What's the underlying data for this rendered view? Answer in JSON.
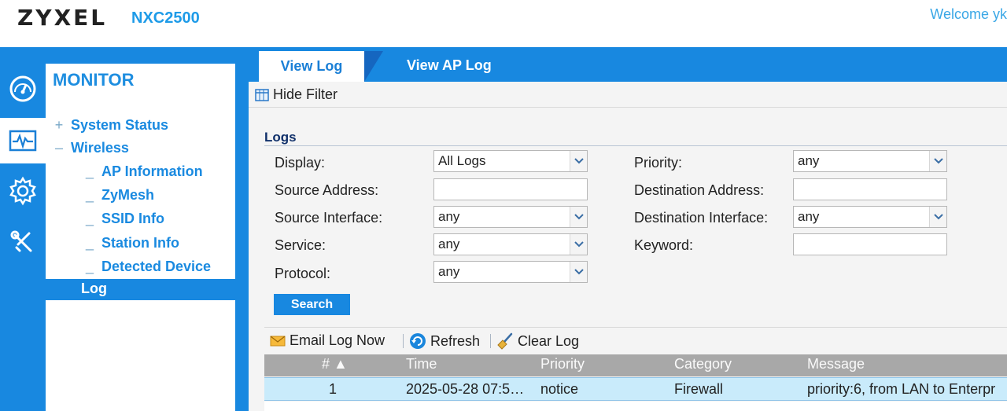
{
  "header": {
    "brand": "ZYXEL",
    "model": "NXC2500",
    "welcome": "Welcome yk"
  },
  "rail": {
    "icons": [
      "speedometer-icon",
      "pulse-monitor-icon",
      "gear-icon",
      "tools-icon"
    ]
  },
  "sidebar": {
    "title": "MONITOR",
    "items": [
      {
        "marker": "+",
        "label": "System Status"
      },
      {
        "marker": "–",
        "label": "Wireless"
      },
      {
        "marker": "_",
        "label": "AP Information"
      },
      {
        "marker": "_",
        "label": "ZyMesh"
      },
      {
        "marker": "_",
        "label": "SSID Info"
      },
      {
        "marker": "_",
        "label": "Station Info"
      },
      {
        "marker": "_",
        "label": "Detected Device"
      }
    ],
    "selected": {
      "label": "Log"
    }
  },
  "tabs": {
    "active": "View Log",
    "other": "View AP Log"
  },
  "filter": {
    "hide_filter_label": "Hide Filter",
    "section_title": "Logs",
    "display_label": "Display:",
    "display_value": "All Logs",
    "priority_label": "Priority:",
    "priority_value": "any",
    "source_address_label": "Source Address:",
    "source_address_value": "",
    "destination_address_label": "Destination Address:",
    "destination_address_value": "",
    "source_interface_label": "Source Interface:",
    "source_interface_value": "any",
    "destination_interface_label": "Destination Interface:",
    "destination_interface_value": "any",
    "service_label": "Service:",
    "service_value": "any",
    "keyword_label": "Keyword:",
    "keyword_value": "",
    "protocol_label": "Protocol:",
    "protocol_value": "any",
    "search_label": "Search"
  },
  "toolbar": {
    "email_label": "Email Log Now",
    "refresh_label": "Refresh",
    "clear_label": "Clear Log"
  },
  "table": {
    "columns": [
      "# ▲",
      "Time",
      "Priority",
      "Category",
      "Message"
    ],
    "rows": [
      [
        "1",
        "2025-05-28 07:5…",
        "notice",
        "Firewall",
        "priority:6, from LAN to Enterpr"
      ]
    ]
  },
  "colors": {
    "brand_blue": "#1888e0",
    "selected_row": "#c9ebfb",
    "header_gray": "#a8a8a8"
  }
}
